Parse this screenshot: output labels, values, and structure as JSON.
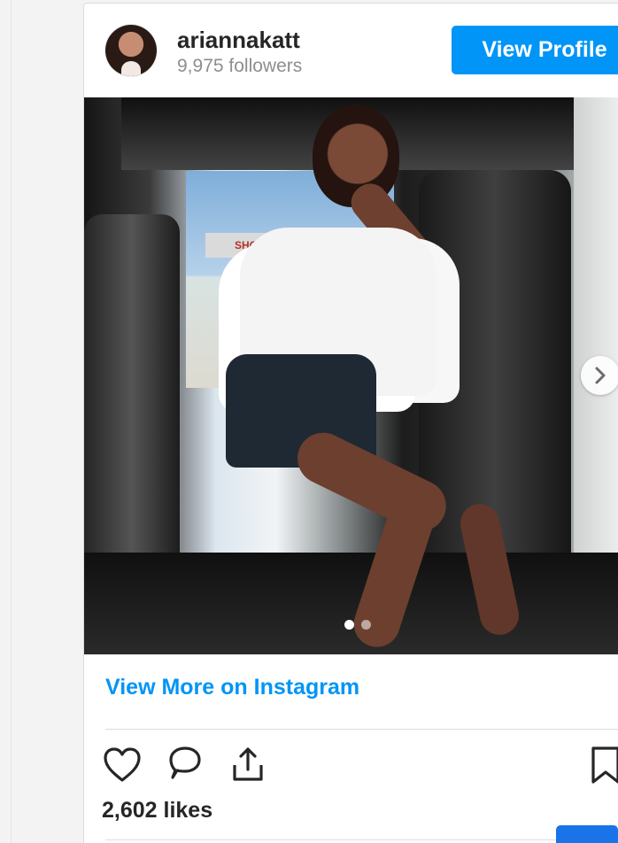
{
  "profile": {
    "username": "ariannakatt",
    "followers_text": "9,975 followers",
    "view_profile_label": "View Profile"
  },
  "post": {
    "image_sign_text": "SHO",
    "carousel_pages": 2,
    "current_page": 1
  },
  "links": {
    "view_more_label": "View More on Instagram"
  },
  "stats": {
    "likes_text": "2,602 likes"
  },
  "icons": {
    "like": "heart-icon",
    "comment": "comment-icon",
    "share": "share-icon",
    "save": "bookmark-icon",
    "next": "chevron-right-icon"
  },
  "colors": {
    "accent": "#0095f6",
    "text": "#262626",
    "muted": "#8e8e8e",
    "border": "#dbdbdb"
  }
}
